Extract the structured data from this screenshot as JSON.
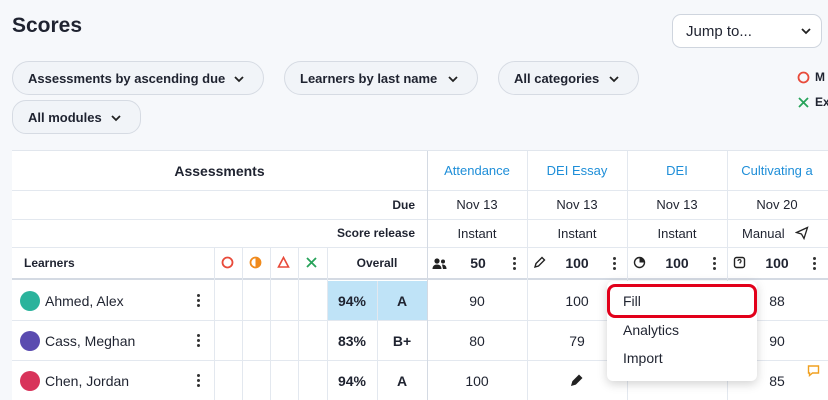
{
  "page": {
    "title": "Scores"
  },
  "jump": {
    "label": "Jump to..."
  },
  "filters": {
    "sort_assessments": "Assessments by ascending due",
    "sort_learners": "Learners by last name",
    "categories": "All categories",
    "modules": "All modules"
  },
  "legend": {
    "item1": "M",
    "item2": "Ex"
  },
  "table": {
    "assessments_header": "Assessments",
    "due_label": "Due",
    "release_label": "Score release",
    "learners_label": "Learners",
    "overall_label": "Overall",
    "columns": [
      {
        "name": "Attendance",
        "due": "Nov 13",
        "release": "Instant",
        "points": "50"
      },
      {
        "name": "DEI Essay",
        "due": "Nov 13",
        "release": "Instant",
        "points": "100"
      },
      {
        "name": "DEI",
        "due": "Nov 13",
        "release": "Instant",
        "points": "100"
      },
      {
        "name": "Cultivating a",
        "due": "Nov 20",
        "release": "Manual",
        "points": "100"
      }
    ],
    "rows": [
      {
        "name": "Ahmed, Alex",
        "percent": "94%",
        "grade": "A",
        "scores": [
          "90",
          "100",
          "",
          "88"
        ]
      },
      {
        "name": "Cass, Meghan",
        "percent": "83%",
        "grade": "B+",
        "scores": [
          "80",
          "79",
          "",
          "90"
        ]
      },
      {
        "name": "Chen, Jordan",
        "percent": "94%",
        "grade": "A",
        "scores": [
          "100",
          "",
          "",
          "85"
        ]
      }
    ]
  },
  "menu": {
    "fill": "Fill",
    "analytics": "Analytics",
    "import": "Import"
  },
  "colors": {
    "accent": "#1e8ed8",
    "highlight": "#bfe3f7",
    "alert": "#e2001a"
  }
}
